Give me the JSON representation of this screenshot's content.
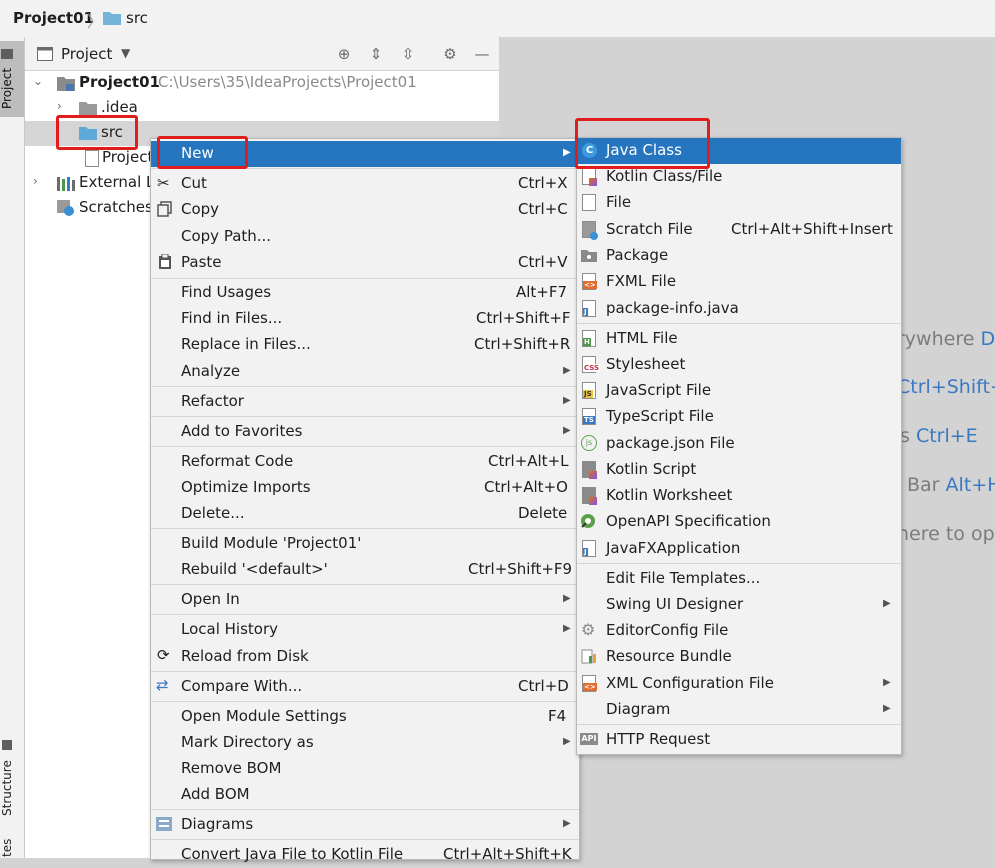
{
  "breadcrumb": {
    "project": "Project01",
    "folder": "src"
  },
  "side_tabs": {
    "project": "Project",
    "structure": "Structure",
    "favorites": "tes"
  },
  "project_panel": {
    "title": "Project",
    "tree": {
      "root_name": "Project01",
      "root_path": "C:\\Users\\35\\IdeaProjects\\Project01",
      "idea": ".idea",
      "src": "src",
      "project_file": "Project",
      "external": "External L",
      "scratches": "Scratches"
    }
  },
  "editor_hints": {
    "h1": "rywhere",
    "h1k": "D",
    "h2k": "Ctrl+Shift+",
    "h3": "s",
    "h3k": "Ctrl+E",
    "h4": "Bar",
    "h4k": "Alt+H",
    "h5": "here to op"
  },
  "context_menu": {
    "new": "New",
    "cut": "Cut",
    "cut_sc": "Ctrl+X",
    "copy": "Copy",
    "copy_sc": "Ctrl+C",
    "copy_path": "Copy Path...",
    "paste": "Paste",
    "paste_sc": "Ctrl+V",
    "find_usages": "Find Usages",
    "find_usages_sc": "Alt+F7",
    "find_in_files": "Find in Files...",
    "find_in_files_sc": "Ctrl+Shift+F",
    "replace_in_files": "Replace in Files...",
    "replace_in_files_sc": "Ctrl+Shift+R",
    "analyze": "Analyze",
    "refactor": "Refactor",
    "add_to_favorites": "Add to Favorites",
    "reformat_code": "Reformat Code",
    "reformat_code_sc": "Ctrl+Alt+L",
    "optimize_imports": "Optimize Imports",
    "optimize_imports_sc": "Ctrl+Alt+O",
    "delete": "Delete...",
    "delete_sc": "Delete",
    "build_module": "Build Module 'Project01'",
    "rebuild": "Rebuild '<default>'",
    "rebuild_sc": "Ctrl+Shift+F9",
    "open_in": "Open In",
    "local_history": "Local History",
    "reload_from_disk": "Reload from Disk",
    "compare_with": "Compare With...",
    "compare_with_sc": "Ctrl+D",
    "open_module_settings": "Open Module Settings",
    "open_module_settings_sc": "F4",
    "mark_directory_as": "Mark Directory as",
    "remove_bom": "Remove BOM",
    "add_bom": "Add BOM",
    "diagrams": "Diagrams",
    "convert_java": "Convert Java File to Kotlin File",
    "convert_java_sc": "Ctrl+Alt+Shift+K"
  },
  "new_submenu": {
    "java_class": "Java Class",
    "kotlin_class": "Kotlin Class/File",
    "file": "File",
    "scratch_file": "Scratch File",
    "scratch_file_sc": "Ctrl+Alt+Shift+Insert",
    "package": "Package",
    "fxml_file": "FXML File",
    "package_info": "package-info.java",
    "html_file": "HTML File",
    "stylesheet": "Stylesheet",
    "javascript_file": "JavaScript File",
    "typescript_file": "TypeScript File",
    "package_json": "package.json File",
    "kotlin_script": "Kotlin Script",
    "kotlin_worksheet": "Kotlin Worksheet",
    "openapi": "OpenAPI Specification",
    "javafx_app": "JavaFXApplication",
    "edit_file_templates": "Edit File Templates...",
    "swing_ui_designer": "Swing UI Designer",
    "editorconfig": "EditorConfig File",
    "resource_bundle": "Resource Bundle",
    "xml_config": "XML Configuration File",
    "diagram": "Diagram",
    "http_request": "HTTP Request"
  },
  "colors": {
    "selection": "#2675bf",
    "highlight_box": "#e01c1c",
    "shortcut": "#3b78c4"
  },
  "icons": [
    "folder-icon",
    "scissors-icon",
    "copy-icon",
    "paste-icon",
    "reload-icon",
    "compare-icon",
    "diagrams-icon",
    "java-class-icon",
    "kotlin-icon",
    "file-icon",
    "package-icon",
    "html-icon",
    "css-icon",
    "js-icon",
    "ts-icon",
    "json-icon",
    "openapi-icon",
    "gear-icon",
    "bundle-icon",
    "xml-icon",
    "api-icon"
  ]
}
